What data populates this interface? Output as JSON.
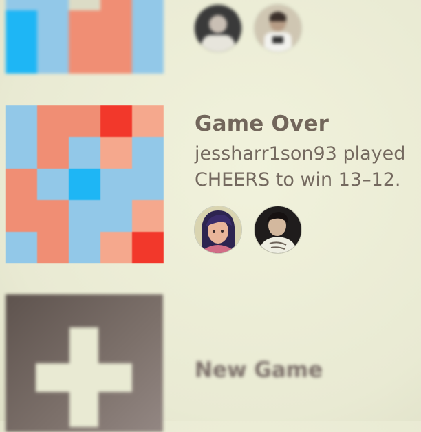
{
  "colors": {
    "light_blue": "#92c8e8",
    "blue": "#1eb6f5",
    "salmon": "#f08e74",
    "light_salmon": "#f5a88d",
    "red": "#f2382b",
    "cream": "#dcdcc6"
  },
  "boards": [
    {
      "cells": [
        [
          "light_blue",
          "light_blue",
          "light_blue",
          "salmon",
          "light_blue"
        ],
        [
          "light_blue",
          "light_blue",
          "light_blue",
          "salmon",
          "light_blue"
        ],
        [
          "light_blue",
          "light_blue",
          "cream",
          "salmon",
          "light_blue"
        ],
        [
          "blue",
          "light_blue",
          "salmon",
          "salmon",
          "light_blue"
        ],
        [
          "blue",
          "light_blue",
          "salmon",
          "salmon",
          "light_blue"
        ]
      ]
    },
    {
      "cells": [
        [
          "light_blue",
          "salmon",
          "salmon",
          "red",
          "light_salmon"
        ],
        [
          "light_blue",
          "salmon",
          "light_blue",
          "light_salmon",
          "light_blue"
        ],
        [
          "salmon",
          "light_blue",
          "blue",
          "light_blue",
          "light_blue"
        ],
        [
          "salmon",
          "salmon",
          "light_blue",
          "light_blue",
          "light_salmon"
        ],
        [
          "light_blue",
          "salmon",
          "light_blue",
          "light_salmon",
          "red"
        ]
      ]
    }
  ],
  "game": {
    "title": "Game Over",
    "description": "jessharr1son93 played CHEERS to win 13–12."
  },
  "new_game": {
    "label": "New Game"
  }
}
